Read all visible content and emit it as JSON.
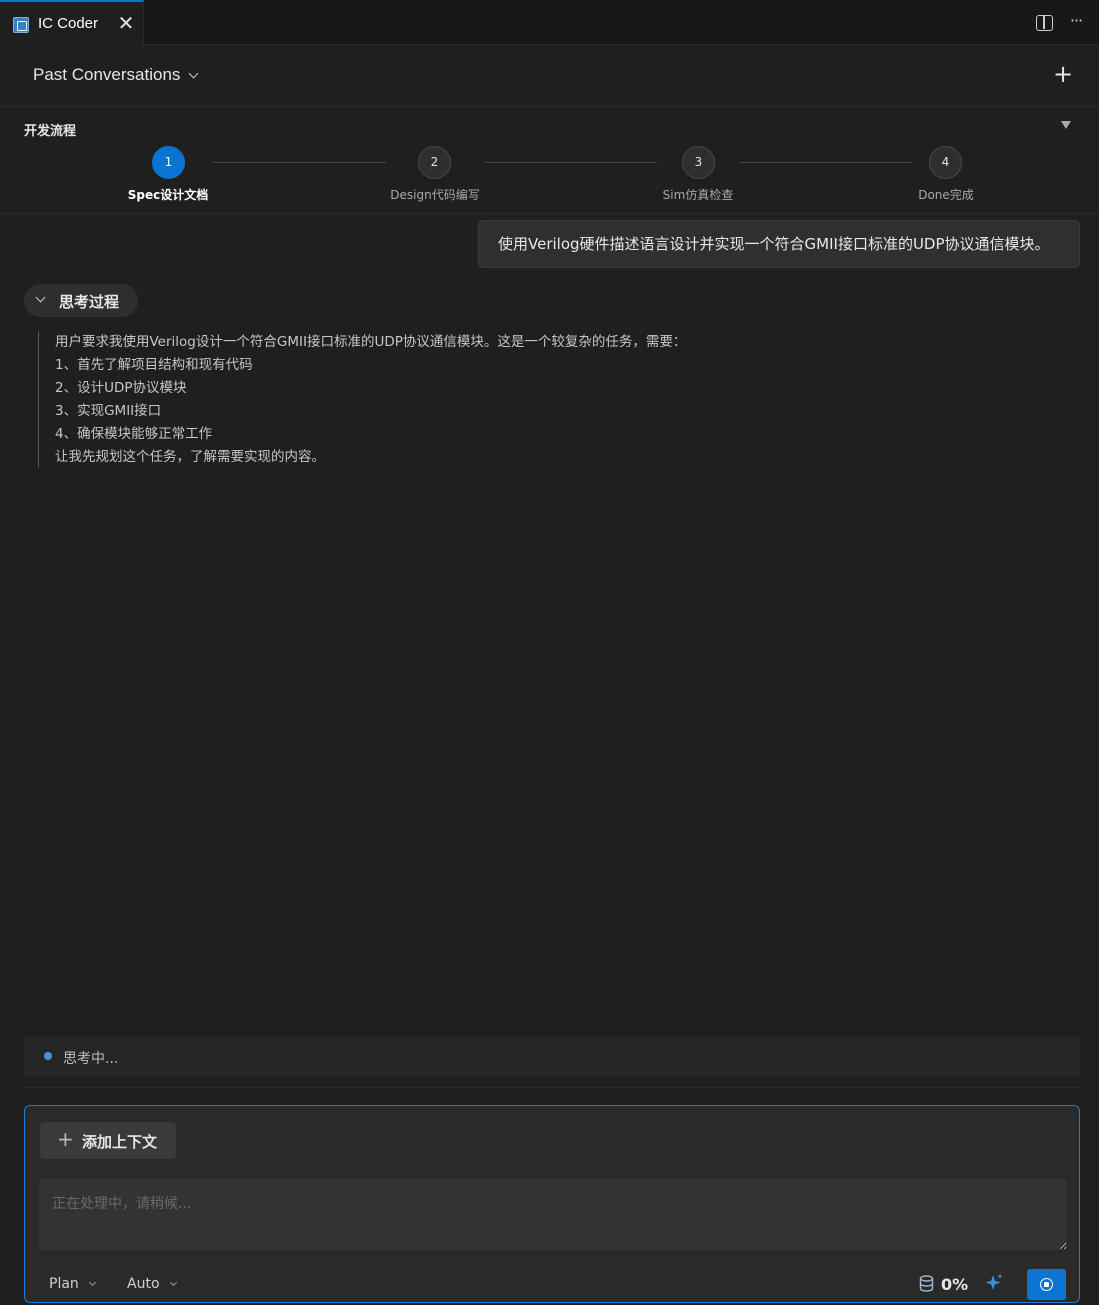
{
  "tab": {
    "title": "IC Coder",
    "close_glyph": "✕"
  },
  "window_actions": {
    "more_glyph": "···"
  },
  "header": {
    "title": "Past Conversations",
    "new_glyph": "+"
  },
  "workflow": {
    "title": "开发流程",
    "steps": [
      {
        "number": "1",
        "label": "Spec设计文档",
        "active": true
      },
      {
        "number": "2",
        "label": "Design代码编写",
        "active": false
      },
      {
        "number": "3",
        "label": "Sim仿真检查",
        "active": false
      },
      {
        "number": "4",
        "label": "Done完成",
        "active": false
      }
    ]
  },
  "user_message": "使用Verilog硬件描述语言设计并实现一个符合GMII接口标准的UDP协议通信模块。",
  "thinking": {
    "label": "思考过程",
    "lines": [
      "用户要求我使用Verilog设计一个符合GMII接口标准的UDP协议通信模块。这是一个较复杂的任务，需要：",
      "1、首先了解项目结构和现有代码",
      "2、设计UDP协议模块",
      "3、实现GMII接口",
      "4、确保模块能够正常工作",
      "让我先规划这个任务，了解需要实现的内容。"
    ]
  },
  "status": {
    "text": "思考中..."
  },
  "composer": {
    "add_context_label": "添加上下文",
    "add_glyph": "+",
    "placeholder": "正在处理中，请稍候...",
    "mode": "Plan",
    "model": "Auto",
    "usage": "0%"
  },
  "colors": {
    "accent": "#0b74d3",
    "background": "#1f1f1f"
  }
}
